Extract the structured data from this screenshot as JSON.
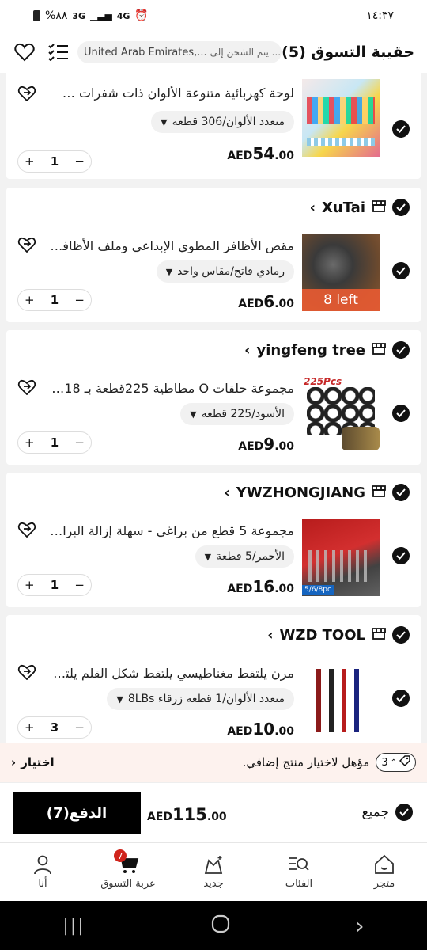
{
  "status": {
    "time": "١٤:٣٧",
    "battery": "%٨٨",
    "network": "3G",
    "network2": "4G"
  },
  "header": {
    "title": "حقيبة التسوق (5)",
    "ship_label": "يتم الشحن إلى ...",
    "ship_country": "United Arab Emirates,..."
  },
  "cards": [
    {
      "store": null,
      "title": "لوحة كهربائية متنوعة الألوان ذات شفرات ص...",
      "variant": "متعدد الألوان/306 قطعة",
      "price_big": "54",
      "price_small": ".00",
      "currency": "AED",
      "qty": "1"
    },
    {
      "store": "XuTai",
      "title": "مقص الأظافر المطوي الإبداعي وملف الأظافر...",
      "variant": "رمادي فاتح/مقاس واحد",
      "price_big": "6",
      "price_small": ".00",
      "currency": "AED",
      "qty": "1",
      "stock_badge": "8 left"
    },
    {
      "store": "yingfeng tree",
      "title": "مجموعة حلقات O مطاطية 225قطعة بـ 18 ...",
      "variant": "الأسود/225 قطعة",
      "price_big": "9",
      "price_small": ".00",
      "currency": "AED",
      "qty": "1",
      "thumb_label": "225Pcs"
    },
    {
      "store": "YWZHONGJIANG",
      "title": "مجموعة 5 قطع من براغي - سهلة إزالة البراغ...",
      "variant": "الأحمر/5 قطعة",
      "price_big": "16",
      "price_small": ".00",
      "currency": "AED",
      "qty": "1",
      "thumb_label": "5/6/8pc"
    },
    {
      "store": "WZD TOOL",
      "title": "مرن يلتقط مغناطيسي يلتقط شكل القلم يلتق...",
      "variant": "متعدد الألوان/1 قطعة زرقاء 8LBs",
      "price_big": "10",
      "price_small": ".00",
      "currency": "AED",
      "qty": "3"
    }
  ],
  "promo": {
    "count": "3",
    "text": "مؤهل لاختيار منتج إضافي.",
    "action": "اختيار"
  },
  "checkout": {
    "all_label": "جميع",
    "currency": "AED",
    "total_big": "115",
    "total_small": ".00",
    "pay_label": "الدفع(7)"
  },
  "tabs": [
    {
      "label": "متجر",
      "icon": "home-icon"
    },
    {
      "label": "الفئات",
      "icon": "categories-icon"
    },
    {
      "label": "جديد",
      "icon": "new-icon"
    },
    {
      "label": "عربة التسوق",
      "icon": "cart-icon",
      "badge": "7"
    },
    {
      "label": "أنا",
      "icon": "user-icon"
    }
  ],
  "colors": {
    "accent": "#000000",
    "badge": "#d0241c",
    "promo_bg": "#fdf2ee",
    "stock": "#e65a32"
  }
}
